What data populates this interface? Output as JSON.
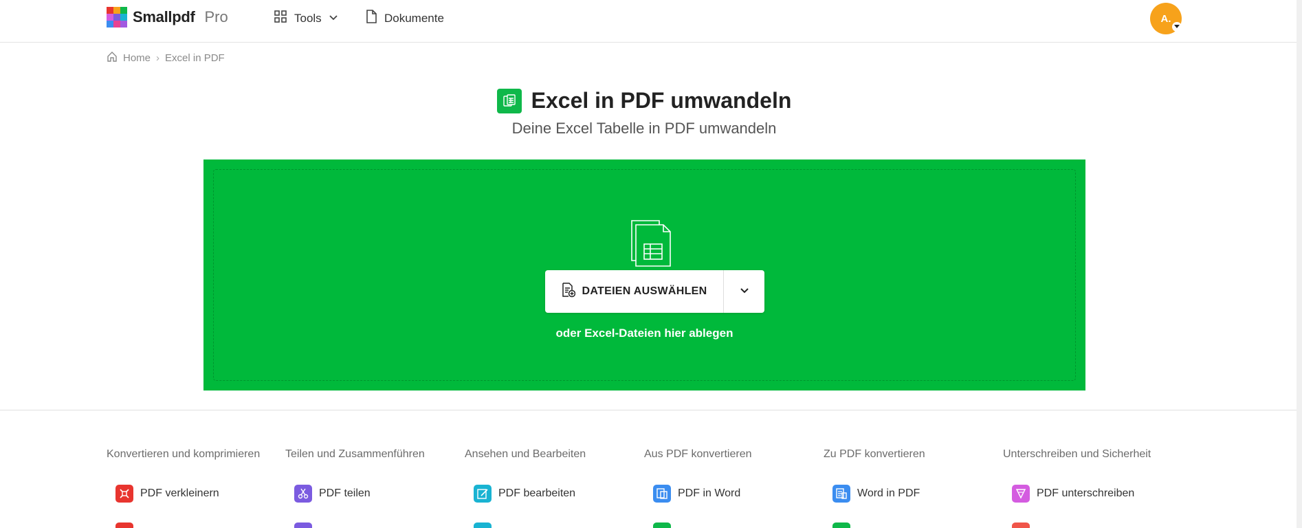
{
  "header": {
    "logo_text": "Smallpdf",
    "logo_pro": "Pro",
    "nav_tools": "Tools",
    "nav_docs": "Dokumente",
    "avatar_initials": "A."
  },
  "breadcrumb": {
    "home": "Home",
    "separator": "›",
    "current": "Excel in PDF"
  },
  "hero": {
    "title": "Excel in PDF umwandeln",
    "subtitle": "Deine Excel Tabelle in PDF umwandeln",
    "icon": "excel-to-pdf-icon",
    "icon_color": "#0fb84a"
  },
  "dropzone": {
    "background_color": "#00b93b",
    "choose_label": "DATEIEN AUSWÄHLEN",
    "hint": "oder Excel-Dateien hier ablegen"
  },
  "categories": [
    {
      "title": "Konvertieren und komprimieren",
      "tool": "PDF verkleinern",
      "color": "#e8352f"
    },
    {
      "title": "Teilen und Zusammenführen",
      "tool": "PDF teilen",
      "color": "#7b5be0"
    },
    {
      "title": "Ansehen und Bearbeiten",
      "tool": "PDF bearbeiten",
      "color": "#19b3d2"
    },
    {
      "title": "Aus PDF konvertieren",
      "tool": "PDF in Word",
      "color": "#3b8df0"
    },
    {
      "title": "Zu PDF konvertieren",
      "tool": "Word in PDF",
      "color": "#3b8df0"
    },
    {
      "title": "Unterschreiben und Sicherheit",
      "tool": "PDF unterschreiben",
      "color": "#d45ce0"
    }
  ],
  "peek_colors": [
    "#e8352f",
    "#7b5be0",
    "#19b3d2",
    "#0fb84a",
    "#0fb84a",
    "#f0554a"
  ]
}
